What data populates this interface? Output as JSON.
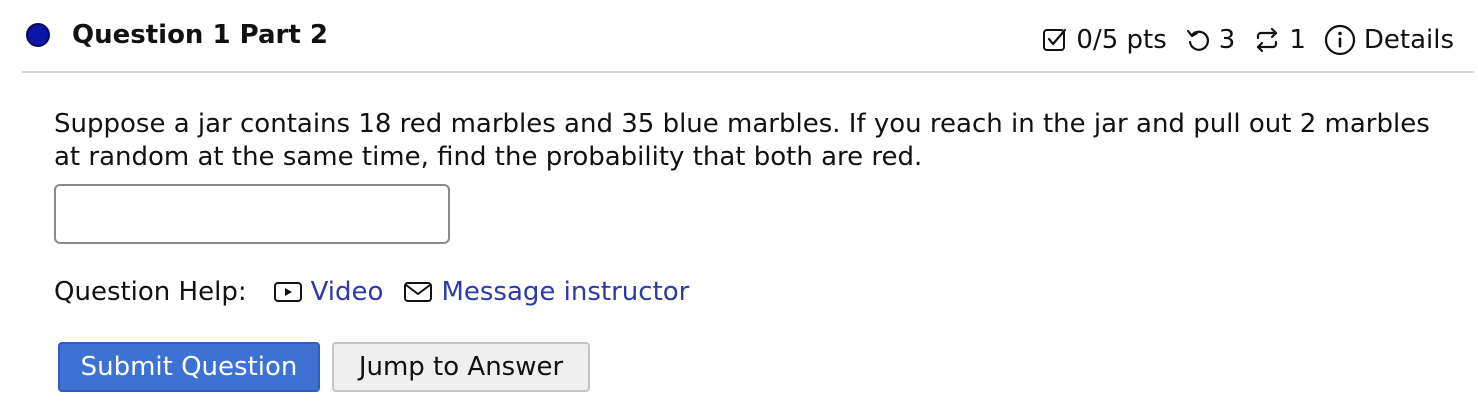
{
  "header": {
    "title": "Question 1 Part 2",
    "points": "0/5 pts",
    "retries": "3",
    "attempts": "1",
    "details_label": "Details"
  },
  "question": {
    "text": "Suppose a jar contains 18 red marbles and 35 blue marbles. If you reach in the jar and pull out 2 marbles at random at the same time, find the probability that both are red.",
    "answer_value": ""
  },
  "help": {
    "label": "Question Help:",
    "video_label": "Video",
    "message_label": "Message instructor"
  },
  "buttons": {
    "submit_label": "Submit Question",
    "jump_label": "Jump to Answer"
  },
  "icons": {
    "status": "status-dot-icon",
    "points": "checkbox-icon",
    "retries": "undo-icon",
    "attempts": "repeat-icon",
    "details": "info-icon",
    "video": "video-icon",
    "message": "mail-icon"
  },
  "colors": {
    "status_dot": "#0b16a8",
    "link": "#2b3aa8",
    "primary_button": "#3d72d4"
  }
}
